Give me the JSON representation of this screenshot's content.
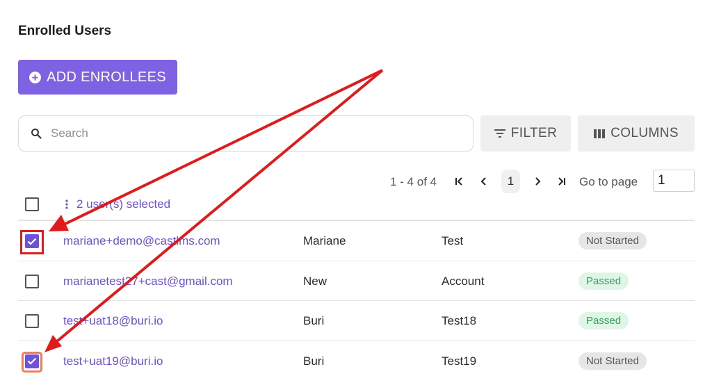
{
  "page": {
    "title": "Enrolled Users"
  },
  "actions": {
    "add_enrollees": "ADD ENROLLEES"
  },
  "search": {
    "placeholder": "Search",
    "value": ""
  },
  "toolbar": {
    "filter": "FILTER",
    "columns": "COLUMNS"
  },
  "pagination": {
    "range": "1 - 4 of 4",
    "current_page": "1",
    "goto_label": "Go to page",
    "goto_value": "1"
  },
  "selection": {
    "label": "2 user(s) selected",
    "header_checked": false
  },
  "rows": [
    {
      "email": "mariane+demo@castlms.com",
      "first_name": "Mariane",
      "last_name": "Test",
      "status": "Not Started",
      "checked": true
    },
    {
      "email": "marianetest27+cast@gmail.com",
      "first_name": "New",
      "last_name": "Account",
      "status": "Passed",
      "checked": false
    },
    {
      "email": "test+uat18@buri.io",
      "first_name": "Buri",
      "last_name": "Test18",
      "status": "Passed",
      "checked": false
    },
    {
      "email": "test+uat19@buri.io",
      "first_name": "Buri",
      "last_name": "Test19",
      "status": "Not Started",
      "checked": true
    }
  ],
  "icons": {
    "add": "plus-circle-icon",
    "search": "search-icon",
    "filter": "filter-lines-icon",
    "columns": "columns-icon",
    "first_page": "first-page-icon",
    "prev_page": "chevron-left-icon",
    "next_page": "chevron-right-icon",
    "last_page": "last-page-icon",
    "more": "more-vertical-icon",
    "check": "check-icon"
  },
  "colors": {
    "accent": "#7f62e3",
    "link": "#6c4fd3",
    "annotation": "#e01b1b",
    "passed_bg": "#dff6e6",
    "passed_text": "#2f9e5a",
    "not_started_bg": "#e6e6e6"
  }
}
